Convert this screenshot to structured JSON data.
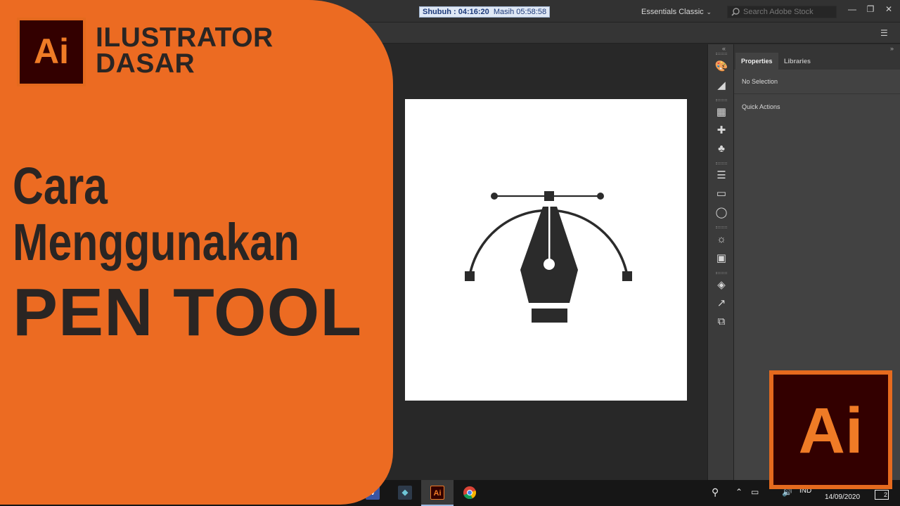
{
  "timer": {
    "label": "Shubuh : 04:16:20",
    "remaining": "Masih 05:58:58"
  },
  "workspace": {
    "name": "Essentials Classic"
  },
  "search": {
    "placeholder": "Search Adobe Stock"
  },
  "window_controls": {
    "minimize": "—",
    "restore": "❐",
    "close": "✕"
  },
  "panel": {
    "tabs": [
      {
        "label": "Properties",
        "active": true
      },
      {
        "label": "Libraries",
        "active": false
      }
    ],
    "selection_text": "No Selection",
    "quick_actions": "Quick Actions"
  },
  "thumbnail": {
    "logo_text": "Ai",
    "series_line1": "ILUSTRATOR",
    "series_line2": "DASAR",
    "headline_line1": "Cara",
    "headline_line2": "Menggunakan",
    "headline_line3": "PEN TOOL",
    "corner_logo_text": "Ai"
  },
  "taskbar": {
    "apps": [
      {
        "name": "visio",
        "label": "V",
        "active": false
      },
      {
        "name": "filmora",
        "label": "◆",
        "active": false
      },
      {
        "name": "illustrator",
        "label": "Ai",
        "active": true
      },
      {
        "name": "chrome",
        "label": "",
        "active": false
      }
    ],
    "language": "IND",
    "date": "14/09/2020",
    "notification_count": "2"
  },
  "colors": {
    "brand_orange": "#ec6b22",
    "ai_dark": "#330000",
    "ai_orange": "#ef7b26"
  }
}
